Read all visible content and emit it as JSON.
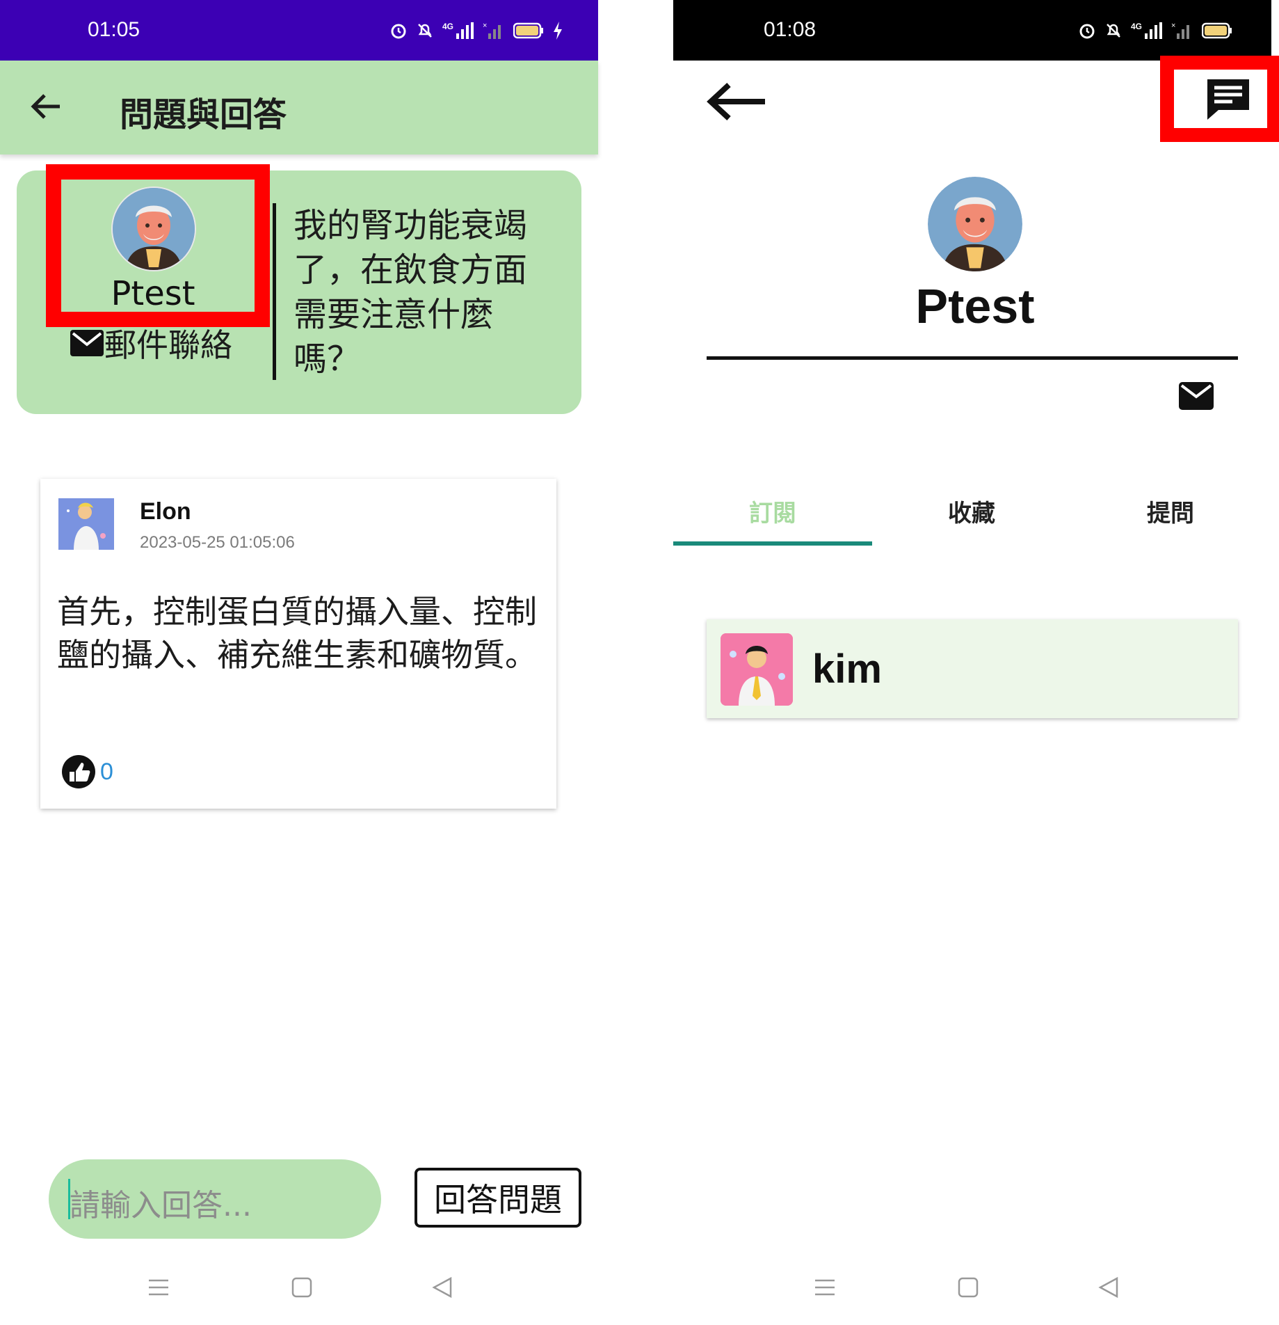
{
  "colors": {
    "status_bar_left": "#3c00b4",
    "status_bar_right": "#000000",
    "app_green": "#b8e2b2",
    "highlight_red": "#ff0000",
    "tab_indicator": "#1a8a7a",
    "like_count": "#2b8fd6"
  },
  "left_screen": {
    "status_bar": {
      "time": "01:05",
      "icons": [
        "alarm-icon",
        "mute-icon",
        "4g-signal-icon",
        "no-signal-icon",
        "battery-icon",
        "charging-icon"
      ]
    },
    "app_bar": {
      "back_icon": "arrow-left-icon",
      "title": "問題與回答"
    },
    "question_card": {
      "author_name": "Ptest",
      "mail_contact_label": "郵件聯絡",
      "question_text": "我的腎功能衰竭了，在飲食方面需要注意什麼嗎？"
    },
    "answer_card": {
      "username": "Elon",
      "timestamp": "2023-05-25 01:05:06",
      "answer_text": "首先，控制蛋白質的攝入量、控制鹽的攝入、補充維生素和礦物質。",
      "like_count": "0"
    },
    "reply": {
      "placeholder": "請輸入回答...",
      "button_label": "回答問題"
    },
    "nav_bar": {
      "icons": [
        "menu-icon",
        "home-icon",
        "back-triangle-icon"
      ]
    }
  },
  "right_screen": {
    "status_bar": {
      "time": "01:08",
      "icons": [
        "alarm-icon",
        "mute-icon",
        "4g-signal-icon",
        "no-signal-icon",
        "battery-icon"
      ]
    },
    "toolbar": {
      "back_icon": "arrow-left-icon",
      "message_icon": "message-icon"
    },
    "profile": {
      "name": "Ptest",
      "mail_icon": "mail-icon"
    },
    "tabs": [
      {
        "label": "訂閱",
        "active": true
      },
      {
        "label": "收藏",
        "active": false
      },
      {
        "label": "提問",
        "active": false
      }
    ],
    "subscriptions": [
      {
        "name": "kim"
      }
    ],
    "nav_bar": {
      "icons": [
        "menu-icon",
        "home-icon",
        "back-triangle-icon"
      ]
    }
  }
}
